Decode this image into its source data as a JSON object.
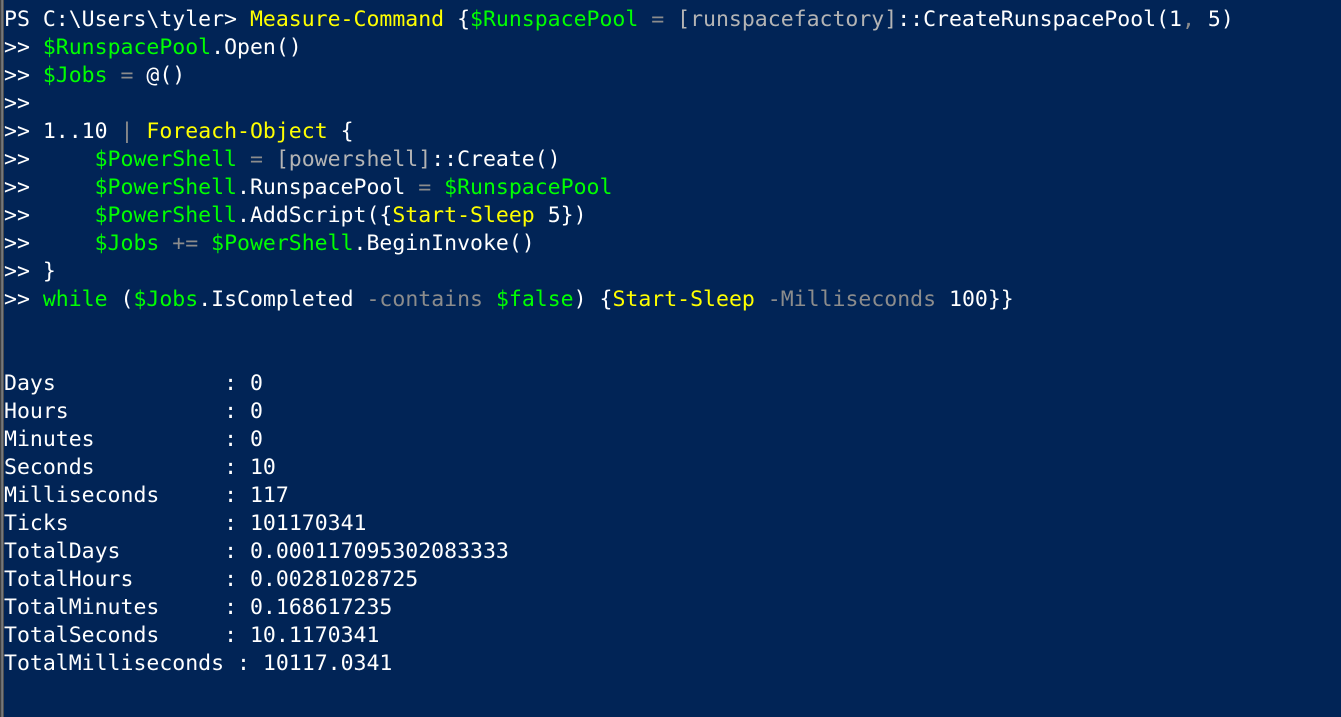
{
  "window": {
    "title": "Windows PowerShell",
    "background_color": "#012456",
    "foreground_color": "#ffffff"
  },
  "palette": {
    "background": "#012456",
    "default": "#ffffff",
    "command": "#ffff00",
    "variable": "#00ff00",
    "keyword": "#00ff00",
    "type": "#b4b4b4",
    "operator": "#8c8c8c",
    "parameter": "#8c8c8c",
    "number": "#ffffff"
  },
  "prompt": {
    "text": "PS C:\\Users\\tyler>",
    "continuation": ">>"
  },
  "lines": [
    {
      "id": "cmd-line-1",
      "tokens": [
        {
          "t": "PS C:\\Users\\tyler> ",
          "c": "prompt"
        },
        {
          "t": "Measure-Command",
          "c": "command"
        },
        {
          "t": " {",
          "c": "punct"
        },
        {
          "t": "$RunspacePool",
          "c": "variable"
        },
        {
          "t": " = ",
          "c": "operator"
        },
        {
          "t": "[runspacefactory]",
          "c": "type"
        },
        {
          "t": "::CreateRunspacePool(",
          "c": "default"
        },
        {
          "t": "1",
          "c": "number"
        },
        {
          "t": ", ",
          "c": "operator"
        },
        {
          "t": "5",
          "c": "number"
        },
        {
          "t": ")",
          "c": "default"
        }
      ]
    },
    {
      "id": "cmd-line-2",
      "tokens": [
        {
          "t": ">> ",
          "c": "cont"
        },
        {
          "t": "$RunspacePool",
          "c": "variable"
        },
        {
          "t": ".Open()",
          "c": "property"
        }
      ]
    },
    {
      "id": "cmd-line-3",
      "tokens": [
        {
          "t": ">> ",
          "c": "cont"
        },
        {
          "t": "$Jobs",
          "c": "variable"
        },
        {
          "t": " = ",
          "c": "operator"
        },
        {
          "t": "@()",
          "c": "default"
        }
      ]
    },
    {
      "id": "cmd-line-4",
      "tokens": [
        {
          "t": ">>",
          "c": "cont"
        }
      ]
    },
    {
      "id": "cmd-line-5",
      "tokens": [
        {
          "t": ">> ",
          "c": "cont"
        },
        {
          "t": "1..10",
          "c": "number"
        },
        {
          "t": " | ",
          "c": "operator"
        },
        {
          "t": "Foreach-Object",
          "c": "command"
        },
        {
          "t": " {",
          "c": "punct"
        }
      ]
    },
    {
      "id": "cmd-line-6",
      "tokens": [
        {
          "t": ">>     ",
          "c": "cont"
        },
        {
          "t": "$PowerShell",
          "c": "variable"
        },
        {
          "t": " = ",
          "c": "operator"
        },
        {
          "t": "[powershell]",
          "c": "type"
        },
        {
          "t": "::Create()",
          "c": "default"
        }
      ]
    },
    {
      "id": "cmd-line-7",
      "tokens": [
        {
          "t": ">>     ",
          "c": "cont"
        },
        {
          "t": "$PowerShell",
          "c": "variable"
        },
        {
          "t": ".RunspacePool",
          "c": "property"
        },
        {
          "t": " = ",
          "c": "operator"
        },
        {
          "t": "$RunspacePool",
          "c": "variable"
        }
      ]
    },
    {
      "id": "cmd-line-8",
      "tokens": [
        {
          "t": ">>     ",
          "c": "cont"
        },
        {
          "t": "$PowerShell",
          "c": "variable"
        },
        {
          "t": ".AddScript({",
          "c": "property"
        },
        {
          "t": "Start-Sleep",
          "c": "command"
        },
        {
          "t": " ",
          "c": "default"
        },
        {
          "t": "5",
          "c": "number"
        },
        {
          "t": "})",
          "c": "default"
        }
      ]
    },
    {
      "id": "cmd-line-9",
      "tokens": [
        {
          "t": ">>     ",
          "c": "cont"
        },
        {
          "t": "$Jobs",
          "c": "variable"
        },
        {
          "t": " += ",
          "c": "operator"
        },
        {
          "t": "$PowerShell",
          "c": "variable"
        },
        {
          "t": ".BeginInvoke()",
          "c": "property"
        }
      ]
    },
    {
      "id": "cmd-line-10",
      "tokens": [
        {
          "t": ">> ",
          "c": "cont"
        },
        {
          "t": "}",
          "c": "punct"
        }
      ]
    },
    {
      "id": "cmd-line-11",
      "tokens": [
        {
          "t": ">> ",
          "c": "cont"
        },
        {
          "t": "while",
          "c": "keyword"
        },
        {
          "t": " (",
          "c": "default"
        },
        {
          "t": "$Jobs",
          "c": "variable"
        },
        {
          "t": ".IsCompleted",
          "c": "property"
        },
        {
          "t": " -contains ",
          "c": "param"
        },
        {
          "t": "$false",
          "c": "variable"
        },
        {
          "t": ") {",
          "c": "default"
        },
        {
          "t": "Start-Sleep",
          "c": "command"
        },
        {
          "t": " -Milliseconds ",
          "c": "param"
        },
        {
          "t": "100",
          "c": "number"
        },
        {
          "t": "}}",
          "c": "default"
        }
      ]
    },
    {
      "id": "blank-1",
      "tokens": []
    },
    {
      "id": "blank-2",
      "tokens": []
    }
  ],
  "output": {
    "label_width": 16,
    "separator": ":",
    "rows": [
      {
        "name": "Days",
        "value": "0"
      },
      {
        "name": "Hours",
        "value": "0"
      },
      {
        "name": "Minutes",
        "value": "0"
      },
      {
        "name": "Seconds",
        "value": "10"
      },
      {
        "name": "Milliseconds",
        "value": "117"
      },
      {
        "name": "Ticks",
        "value": "101170341"
      },
      {
        "name": "TotalDays",
        "value": "0.000117095302083333"
      },
      {
        "name": "TotalHours",
        "value": "0.00281028725"
      },
      {
        "name": "TotalMinutes",
        "value": "0.168617235"
      },
      {
        "name": "TotalSeconds",
        "value": "10.1170341"
      },
      {
        "name": "TotalMilliseconds",
        "value": "10117.0341"
      }
    ]
  }
}
